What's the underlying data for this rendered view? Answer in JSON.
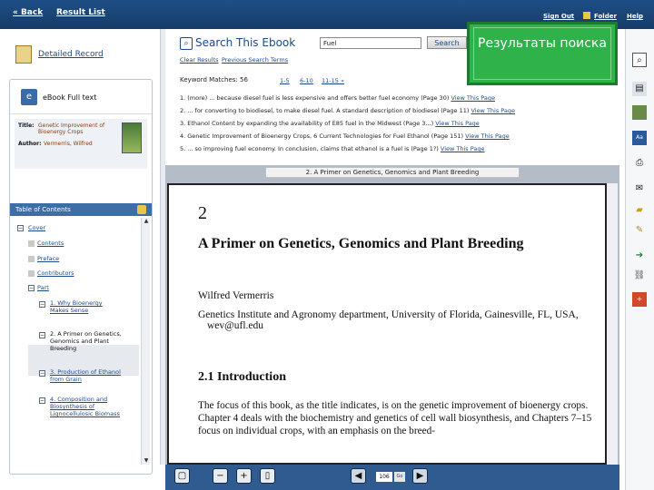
{
  "topbar": {
    "back": "« Back",
    "result_list": "Result List",
    "sign_out": "Sign Out",
    "folder": "Folder",
    "help": "Help"
  },
  "left": {
    "detailed_record": "Detailed Record",
    "ebook_full_text": "eBook Full text",
    "book": {
      "title_label": "Title:",
      "title": "Genetic Improvement of Bioenergy Crops",
      "author_label": "Author:",
      "author": "Vermerris, Wilfred"
    },
    "toc_title": "Table of Contents",
    "toc": [
      "Cover",
      "Contents",
      "Preface",
      "Contributors",
      "Part",
      "1. Why Bioenergy Makes Sense",
      "2. A Primer on Genetics, Genomics and Plant Breeding",
      "3. Production of Ethanol from Grain",
      "4. Composition and Biosynthesis of Lignocellulosic Biomass"
    ]
  },
  "search": {
    "title": "Search This Ebook",
    "query": "Fuel",
    "button": "Search",
    "clear": "Clear Results",
    "previous": "Previous Search Terms",
    "keyword_matches": "Keyword Matches: 56",
    "pages": [
      "1-5",
      "6-10",
      "11-15 »"
    ],
    "results": [
      {
        "text": "1. (more) ... because diesel fuel is less expensive and offers better fuel economy (Page 30)",
        "link": "View This Page"
      },
      {
        "text": "2. ... for converting to biodiesel, to make diesel fuel. A standard description of biodiesel (Page 11)",
        "link": "View This Page"
      },
      {
        "text": "3. Ethanol Content by expanding the availability of E85 fuel in the Midwest (Page 3...)",
        "link": "View This Page"
      },
      {
        "text": "4. Genetic Improvement of Bioenergy Crops, 6 Current Technologies for Fuel Ethanol (Page 151)",
        "link": "View This Page"
      },
      {
        "text": "5. ... so improving fuel economy. In conclusion, claims that ethanol is a fuel is (Page 1?)",
        "link": "View This Page"
      }
    ]
  },
  "overlay": {
    "text": "Результаты поиска"
  },
  "viewer": {
    "tab": "2. A Primer on Genetics, Genomics and Plant Breeding",
    "chapter_num": "2",
    "chapter_title": "A Primer on Genetics, Genomics and Plant Breeding",
    "author": "Wilfred Vermerris",
    "affiliation": "Genetics Institute and Agronomy department, University of Florida, Gainesville, FL, USA,",
    "email": "wev@ufl.edu",
    "section": "2.1 Introduction",
    "body": "The focus of this book, as the title indicates, is on the genetic improvement of bioenergy crops. Chapter 4 deals with the biochemistry and genetics of cell wall biosynthesis, and Chapters 7–15 focus on individual crops, with an emphasis on the breed-"
  },
  "toolbar": {
    "page_input": "106",
    "go": "Go"
  }
}
